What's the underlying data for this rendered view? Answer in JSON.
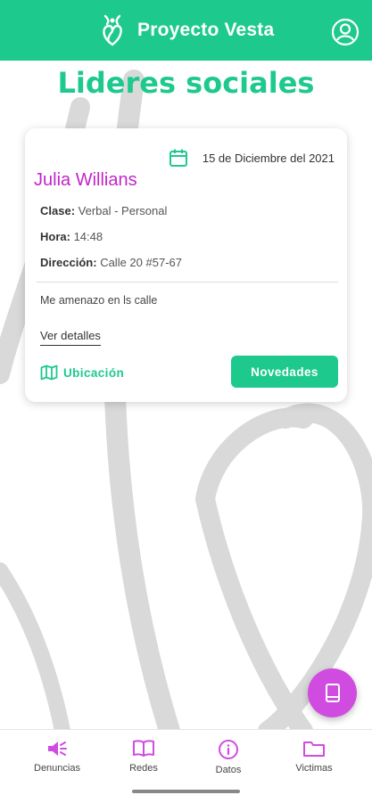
{
  "header": {
    "brand_name": "Proyecto Vesta"
  },
  "page": {
    "title": "Lideres sociales"
  },
  "card": {
    "date": "15 de Diciembre del 2021",
    "name": "Julia Willians",
    "fields": [
      {
        "label": "Clase:",
        "value": " Verbal - Personal"
      },
      {
        "label": "Hora:",
        "value": " 14:48"
      },
      {
        "label": "Dirección:",
        "value": " Calle 20 #57-67"
      }
    ],
    "note": "Me amenazo en ls calle",
    "details_link": "Ver detalles",
    "location_label": "Ubicación",
    "news_button": "Novedades"
  },
  "bottom_nav": [
    {
      "label": "Denuncias",
      "icon": "megaphone-icon",
      "active": true
    },
    {
      "label": "Redes",
      "icon": "book-open-icon"
    },
    {
      "label": "Datos",
      "icon": "info-circle-icon"
    },
    {
      "label": "Victimas",
      "icon": "folder-icon"
    }
  ],
  "colors": {
    "primary": "#1ec98d",
    "accent": "#c226c9",
    "fab": "#d04ce0",
    "background_art": "#dcdcdc"
  }
}
